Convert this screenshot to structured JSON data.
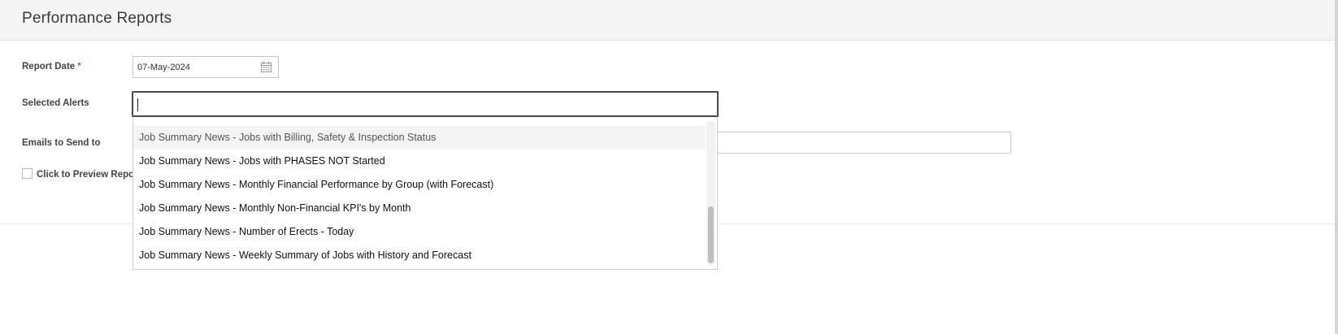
{
  "header": {
    "title": "Performance Reports"
  },
  "form": {
    "report_date_label": "Report Date",
    "required_marker": "*",
    "report_date_value": "07-May-2024",
    "selected_alerts_label": "Selected Alerts",
    "emails_label": "Emails to Send to",
    "preview_label": "Click to Preview Report"
  },
  "dropdown": {
    "items": [
      "Job Summary News - Jobs with Billing, Safety & Inspection Status",
      "Job Summary News - Jobs with PHASES NOT Started",
      "Job Summary News - Monthly Financial Performance by Group (with Forecast)",
      "Job Summary News - Monthly Non-Financial KPI's by Month",
      "Job Summary News - Number of Erects - Today",
      "Job Summary News - Weekly Summary of Jobs with History and Forecast"
    ]
  },
  "icons": {
    "date_picker": "calendar-icon"
  }
}
